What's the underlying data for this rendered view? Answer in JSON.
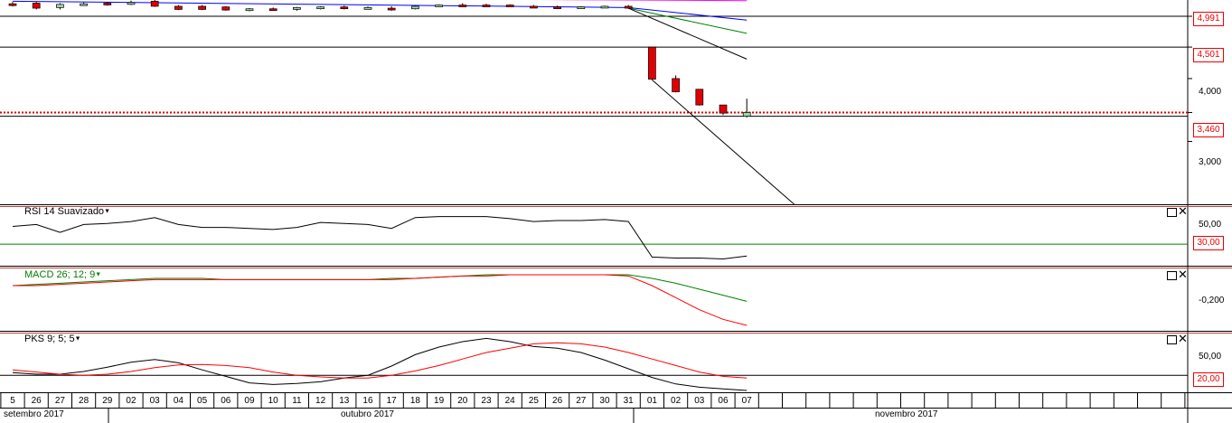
{
  "price_panel": {
    "tags": [
      {
        "label": "4,991",
        "price": 4991,
        "color": "#e00000"
      },
      {
        "label": "4,501",
        "price": 4501,
        "color": "#e00000"
      },
      {
        "label": "3,460",
        "price": 3460,
        "color": "#e00000"
      }
    ],
    "axis_labels": [
      "4,000",
      "3,000"
    ],
    "horizontal_lines": [
      4991,
      4501,
      3400
    ],
    "last_price_line": 3460
  },
  "rsi_panel": {
    "title": "RSI 14 Suavizado",
    "axis_label": "50,00",
    "level_tag": "30,00",
    "level_color": "#008000"
  },
  "macd_panel": {
    "title": "MACD 26; 12; 9",
    "axis_label": "-0,200",
    "title_color": "#008000"
  },
  "pks_panel": {
    "title": "PKS 9; 5; 5",
    "axis_label": "50,00",
    "level_tag": "20,00"
  },
  "panel_controls": {
    "maximize_icon": "maximize-icon",
    "close_icon": "close-icon"
  },
  "date_axis": {
    "days": [
      "5",
      "26",
      "27",
      "28",
      "29",
      "02",
      "03",
      "04",
      "05",
      "06",
      "09",
      "10",
      "11",
      "12",
      "13",
      "16",
      "17",
      "18",
      "19",
      "20",
      "23",
      "24",
      "25",
      "26",
      "27",
      "30",
      "31",
      "01",
      "02",
      "03",
      "06",
      "07"
    ],
    "months": [
      "setembro 2017",
      "outubro 2017",
      "novembro 2017"
    ]
  },
  "chart_data": [
    {
      "type": "candlestick",
      "title": "",
      "x": [
        "25",
        "26",
        "27",
        "28",
        "29",
        "02",
        "03",
        "04",
        "05",
        "06",
        "09",
        "10",
        "11",
        "12",
        "13",
        "16",
        "17",
        "18",
        "19",
        "20",
        "23",
        "24",
        "25",
        "26",
        "27",
        "30",
        "31",
        "01",
        "02",
        "03",
        "06",
        "07"
      ],
      "candles": [
        {
          "o": 5190,
          "h": 5220,
          "l": 5150,
          "c": 5170
        },
        {
          "o": 5200,
          "h": 5220,
          "l": 5100,
          "c": 5120
        },
        {
          "o": 5130,
          "h": 5200,
          "l": 5100,
          "c": 5180
        },
        {
          "o": 5180,
          "h": 5210,
          "l": 5160,
          "c": 5190
        },
        {
          "o": 5200,
          "h": 5220,
          "l": 5160,
          "c": 5180
        },
        {
          "o": 5180,
          "h": 5240,
          "l": 5170,
          "c": 5210
        },
        {
          "o": 5230,
          "h": 5250,
          "l": 5140,
          "c": 5150
        },
        {
          "o": 5150,
          "h": 5170,
          "l": 5090,
          "c": 5100
        },
        {
          "o": 5150,
          "h": 5170,
          "l": 5090,
          "c": 5100
        },
        {
          "o": 5140,
          "h": 5150,
          "l": 5080,
          "c": 5090
        },
        {
          "o": 5100,
          "h": 5120,
          "l": 5070,
          "c": 5110
        },
        {
          "o": 5110,
          "h": 5130,
          "l": 5080,
          "c": 5090
        },
        {
          "o": 5100,
          "h": 5140,
          "l": 5080,
          "c": 5130
        },
        {
          "o": 5120,
          "h": 5150,
          "l": 5100,
          "c": 5140
        },
        {
          "o": 5140,
          "h": 5160,
          "l": 5100,
          "c": 5120
        },
        {
          "o": 5120,
          "h": 5150,
          "l": 5100,
          "c": 5130
        },
        {
          "o": 5120,
          "h": 5150,
          "l": 5080,
          "c": 5100
        },
        {
          "o": 5110,
          "h": 5160,
          "l": 5100,
          "c": 5150
        },
        {
          "o": 5150,
          "h": 5180,
          "l": 5140,
          "c": 5170
        },
        {
          "o": 5170,
          "h": 5200,
          "l": 5150,
          "c": 5160
        },
        {
          "o": 5170,
          "h": 5190,
          "l": 5150,
          "c": 5160
        },
        {
          "o": 5170,
          "h": 5180,
          "l": 5150,
          "c": 5160
        },
        {
          "o": 5150,
          "h": 5170,
          "l": 5120,
          "c": 5130
        },
        {
          "o": 5140,
          "h": 5160,
          "l": 5120,
          "c": 5130
        },
        {
          "o": 5120,
          "h": 5150,
          "l": 5110,
          "c": 5140
        },
        {
          "o": 5140,
          "h": 5160,
          "l": 5120,
          "c": 5150
        },
        {
          "o": 5150,
          "h": 5170,
          "l": 5110,
          "c": 5120
        },
        {
          "o": 4501,
          "h": 4501,
          "l": 3980,
          "c": 3990
        },
        {
          "o": 4000,
          "h": 4050,
          "l": 3780,
          "c": 3790
        },
        {
          "o": 3830,
          "h": 3830,
          "l": 3570,
          "c": 3580
        },
        {
          "o": 3580,
          "h": 3580,
          "l": 3420,
          "c": 3450
        },
        {
          "o": 3400,
          "h": 3680,
          "l": 3380,
          "c": 3460
        }
      ],
      "up_color": "#9fd89f",
      "down_color": "#e00000",
      "overlays": [
        {
          "color": "#0000ff",
          "points": [
            [
              0,
              5230
            ],
            [
              26,
              5130
            ],
            [
              31,
              4930
            ]
          ]
        },
        {
          "color": "#ff00ff",
          "points": [
            [
              0,
              5300
            ],
            [
              26,
              5250
            ],
            [
              31,
              5240
            ]
          ]
        },
        {
          "color": "#008000",
          "points": [
            [
              26,
              5120
            ],
            [
              31,
              4720
            ]
          ]
        },
        {
          "color": "#000000",
          "points": [
            [
              26,
              5120
            ],
            [
              31,
              4310
            ]
          ]
        },
        {
          "color": "#000000",
          "points": [
            [
              27,
              3980
            ],
            [
              33,
              2000
            ]
          ]
        }
      ],
      "ylim": [
        2000,
        5250
      ]
    },
    {
      "type": "line",
      "title": "RSI 14 Suavizado",
      "series": [
        {
          "color": "#000000",
          "values": [
            48,
            50,
            42,
            50,
            51,
            53,
            57,
            50,
            47,
            47,
            46,
            45,
            47,
            52,
            51,
            50,
            46,
            57,
            58,
            58,
            58,
            56,
            53,
            54,
            54,
            55,
            53,
            17,
            16,
            16,
            15,
            18
          ]
        }
      ],
      "level": 30,
      "ylim": [
        10,
        65
      ]
    },
    {
      "type": "line",
      "title": "MACD 26; 12; 9",
      "series": [
        {
          "color": "#008000",
          "values": [
            0.0,
            0.01,
            0.02,
            0.03,
            0.04,
            0.05,
            0.06,
            0.06,
            0.06,
            0.05,
            0.05,
            0.05,
            0.05,
            0.05,
            0.05,
            0.05,
            0.06,
            0.06,
            0.07,
            0.08,
            0.09,
            0.09,
            0.09,
            0.09,
            0.09,
            0.09,
            0.09,
            0.06,
            0.02,
            -0.03,
            -0.08,
            -0.13
          ]
        },
        {
          "color": "#ff0000",
          "values": [
            0.0,
            0.0,
            0.01,
            0.02,
            0.03,
            0.04,
            0.05,
            0.05,
            0.05,
            0.05,
            0.05,
            0.05,
            0.05,
            0.05,
            0.05,
            0.05,
            0.05,
            0.06,
            0.07,
            0.08,
            0.08,
            0.09,
            0.09,
            0.09,
            0.09,
            0.09,
            0.08,
            0.0,
            -0.1,
            -0.2,
            -0.28,
            -0.33
          ]
        }
      ],
      "ylim": [
        -0.36,
        0.12
      ]
    },
    {
      "type": "line",
      "title": "PKS 9; 5; 5",
      "series": [
        {
          "color": "#000000",
          "values": [
            25,
            22,
            22,
            27,
            35,
            44,
            49,
            43,
            30,
            18,
            6,
            3,
            5,
            8,
            15,
            20,
            37,
            58,
            72,
            82,
            88,
            82,
            73,
            70,
            62,
            48,
            32,
            16,
            4,
            -2,
            -5,
            -8
          ]
        },
        {
          "color": "#ff0000",
          "values": [
            30,
            26,
            22,
            20,
            22,
            27,
            34,
            39,
            40,
            38,
            34,
            26,
            20,
            17,
            15,
            15,
            20,
            28,
            38,
            50,
            62,
            70,
            78,
            80,
            78,
            72,
            62,
            50,
            38,
            26,
            18,
            15
          ]
        }
      ],
      "level": 20,
      "ylim": [
        -8,
        92
      ]
    }
  ]
}
